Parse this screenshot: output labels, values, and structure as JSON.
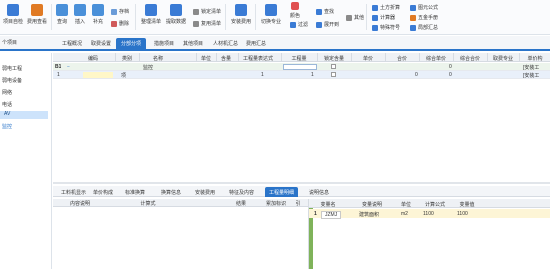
{
  "ribbon": {
    "items": [
      {
        "label": "项目自检",
        "color": "#3a7bd5"
      },
      {
        "label": "费用查看",
        "color": "#e07a24"
      },
      {
        "label": "查询",
        "color": "#4a90d9"
      },
      {
        "label": "插入",
        "color": "#4a90d9"
      },
      {
        "label": "补充",
        "color": "#4a90d9"
      },
      {
        "label": "整理清单",
        "color": "#3a7bd5"
      },
      {
        "label": "提取数据",
        "color": "#3a7bd5"
      },
      {
        "label": "安装费用",
        "color": "#3a7bd5"
      },
      {
        "label": "切换专业",
        "color": "#3a7bd5"
      },
      {
        "label": "颜色",
        "color": "#e05050"
      },
      {
        "label": "展开到",
        "color": "#3a7bd5"
      }
    ],
    "small": {
      "save_as": "存档",
      "delete": "删除",
      "lock_list": "锁定清单",
      "restore_list": "复用清单",
      "find": "查找",
      "filter": "过滤",
      "other": "其他",
      "earthwork": "土方折算",
      "calculator": "计算器",
      "special_symbol": "特殊符号",
      "formula": "图元公式",
      "hardware_manual": "五金手册",
      "local_summary": "局部汇总"
    }
  },
  "sidebar": {
    "header": "个项目",
    "items": [
      {
        "label": "弱电工程",
        "selected": false,
        "link": false
      },
      {
        "label": "弱电设备",
        "selected": false,
        "link": false
      },
      {
        "label": "网络",
        "selected": false,
        "link": false
      },
      {
        "label": "电话",
        "selected": false,
        "link": false
      },
      {
        "label": "AV",
        "selected": true,
        "link": false
      },
      {
        "label": "监控",
        "selected": false,
        "link": true
      }
    ]
  },
  "tabs": [
    {
      "label": "工程概况",
      "active": false
    },
    {
      "label": "取费设置",
      "active": false
    },
    {
      "label": "分部分项",
      "active": true
    },
    {
      "label": "措施项目",
      "active": false
    },
    {
      "label": "其他项目",
      "active": false
    },
    {
      "label": "人材机汇总",
      "active": false
    },
    {
      "label": "费用汇总",
      "active": false
    }
  ],
  "grid": {
    "columns": [
      "编码",
      "类别",
      "名称",
      "单位",
      "含量",
      "工程量表达式",
      "工程量",
      "锁定含量",
      "单价",
      "合价",
      "综合单价",
      "综合合价",
      "取费专业",
      "单价构"
    ],
    "rows": [
      {
        "num": "B1",
        "code": "",
        "type": "",
        "name": "监控",
        "unit": "",
        "qty_expr": "",
        "qty": "",
        "price": "",
        "total_unit": "0",
        "total": "0",
        "major": "",
        "extra": "[安装工"
      },
      {
        "num": "1",
        "code": "",
        "type": "项",
        "name": "",
        "unit": "",
        "qty_expr": "1",
        "qty": "1",
        "price": "",
        "total_unit": "0",
        "total": "0",
        "major": "",
        "extra": "[安装工"
      }
    ]
  },
  "bottom_tabs": [
    {
      "label": "工料机显示",
      "active": false
    },
    {
      "label": "单价构成",
      "active": false
    },
    {
      "label": "标准换算",
      "active": false
    },
    {
      "label": "换算信息",
      "active": false
    },
    {
      "label": "安装费用",
      "active": false
    },
    {
      "label": "特征及内容",
      "active": false
    },
    {
      "label": "工程量明细",
      "active": true
    },
    {
      "label": "说明信息",
      "active": false
    }
  ],
  "detail_table": {
    "columns": [
      "内容说明",
      "计算式",
      "结果",
      "累加标识",
      "引"
    ]
  },
  "variable_table": {
    "columns": [
      "变量名",
      "变量说明",
      "单位",
      "计算公式",
      "变量值"
    ],
    "rows": [
      {
        "num": "1",
        "name": "JZMJ",
        "desc": "建筑面积",
        "unit": "m2",
        "formula": "1100",
        "value": "1100"
      }
    ]
  }
}
